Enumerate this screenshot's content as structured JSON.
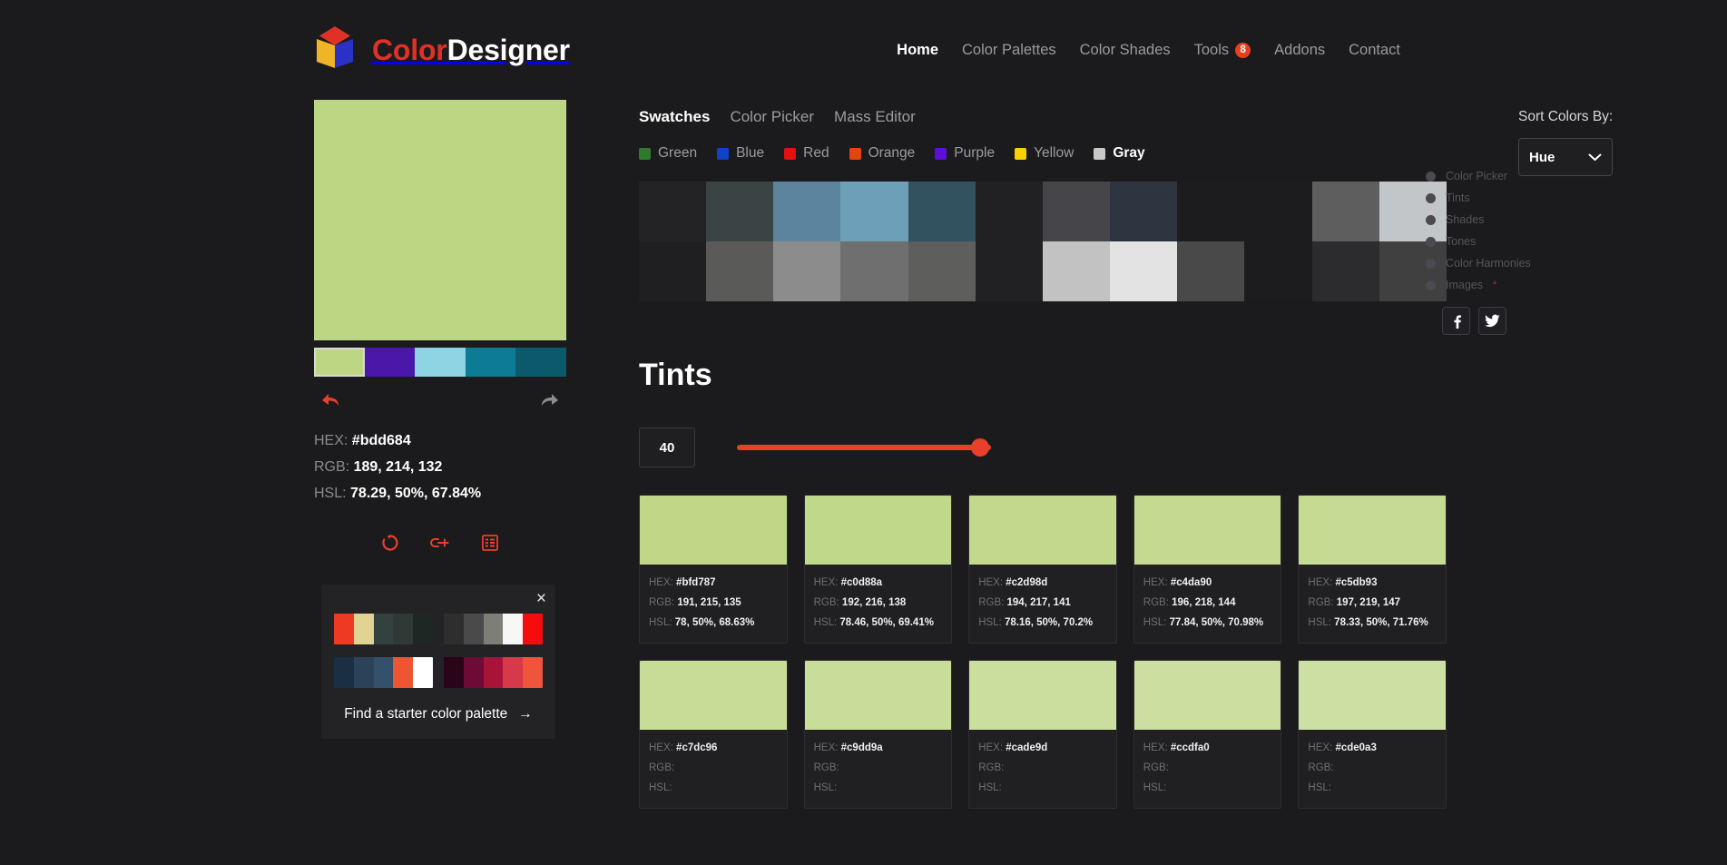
{
  "header": {
    "logo": {
      "part1": "Color",
      "part2": "Designer",
      "icon": "cube-logo-icon"
    },
    "nav": [
      {
        "label": "Home",
        "active": true
      },
      {
        "label": "Color Palettes",
        "active": false
      },
      {
        "label": "Color Shades",
        "active": false
      },
      {
        "label": "Tools",
        "active": false,
        "badge": "8"
      },
      {
        "label": "Addons",
        "active": false
      },
      {
        "label": "Contact",
        "active": false
      }
    ]
  },
  "left": {
    "main_color": "#bdd684",
    "palette": [
      {
        "hex": "#bdd684",
        "selected": true
      },
      {
        "hex": "#4b17a8",
        "selected": false
      },
      {
        "hex": "#8ed4e2",
        "selected": false
      },
      {
        "hex": "#0d7b94",
        "selected": false
      },
      {
        "hex": "#0b5a6b",
        "selected": false
      }
    ],
    "undo_label": "undo",
    "redo_label": "redo",
    "info": [
      {
        "label": "HEX:",
        "value": "#bdd684"
      },
      {
        "label": "RGB:",
        "value": "189, 214, 132"
      },
      {
        "label": "HSL:",
        "value": "78.29, 50%, 67.84%"
      }
    ],
    "actions": [
      {
        "name": "randomize-icon"
      },
      {
        "name": "add-color-icon"
      },
      {
        "name": "list-view-icon"
      }
    ],
    "starter": {
      "close_label": "×",
      "link_label": "Find a starter color palette",
      "arrow": "→",
      "palettes": [
        [
          "#ee3a23",
          "#e1d392",
          "#33413f",
          "#2f3a37",
          "#1f2724"
        ],
        [
          "#2e2e2e",
          "#4a4a4a",
          "#7e7e78",
          "#f7f7f7",
          "#f50d0d"
        ],
        [
          "#1a2f44",
          "#2b4259",
          "#ee5532",
          "#ffffff",
          "#ffffff"
        ],
        [
          "#2a0418",
          "#6d0a35",
          "#a81339",
          "#d6394a",
          "#ef553c"
        ]
      ]
    }
  },
  "main": {
    "tabs": [
      {
        "label": "Swatches",
        "active": true
      },
      {
        "label": "Color Picker",
        "active": false
      },
      {
        "label": "Mass Editor",
        "active": false
      }
    ],
    "categories": [
      {
        "label": "Green",
        "color": "#2d7a2d",
        "active": false
      },
      {
        "label": "Blue",
        "color": "#1042c8",
        "active": false
      },
      {
        "label": "Red",
        "color": "#e60f0f",
        "active": false
      },
      {
        "label": "Orange",
        "color": "#e2450f",
        "active": false
      },
      {
        "label": "Purple",
        "color": "#5c0fd8",
        "active": false
      },
      {
        "label": "Yellow",
        "color": "#fbd000",
        "active": false
      },
      {
        "label": "Gray",
        "color": "#c9c9c9",
        "active": true
      }
    ],
    "swatch_grid": {
      "rows": [
        [
          "#232326",
          "#3b4444",
          "#5d849e",
          "#6d9fb9",
          "#32525f",
          "#212124",
          "#45454a",
          "#2e3440",
          "#1c1c1f",
          "#1c1c1f",
          "#5e5e5e",
          "#c3c6c8"
        ],
        [
          "#1f1f22",
          "#5a5a58",
          "#8c8c8c",
          "#6f6f6f",
          "#5e5e5c",
          "#212124",
          "#c2c2c2",
          "#e3e3e3",
          "#49494a",
          "#1c1c1f",
          "#2c2c2f",
          "#404040"
        ]
      ]
    },
    "section_title": "Tints",
    "slider": {
      "value": "40",
      "min": "0",
      "max": "50",
      "fill_color": "#e8402a"
    },
    "tints": [
      {
        "chip": "#bfd787",
        "hex": "#bfd787",
        "rgb": "191, 215, 135",
        "hsl": "78, 50%, 68.63%"
      },
      {
        "chip": "#c0d88a",
        "hex": "#c0d88a",
        "rgb": "192, 216, 138",
        "hsl": "78.46, 50%, 69.41%"
      },
      {
        "chip": "#c2d98d",
        "hex": "#c2d98d",
        "rgb": "194, 217, 141",
        "hsl": "78.16, 50%, 70.2%"
      },
      {
        "chip": "#c4da90",
        "hex": "#c4da90",
        "rgb": "196, 218, 144",
        "hsl": "77.84, 50%, 70.98%"
      },
      {
        "chip": "#c5db93",
        "hex": "#c5db93",
        "rgb": "197, 219, 147",
        "hsl": "78.33, 50%, 71.76%"
      },
      {
        "chip": "#c7dc96",
        "hex": "#c7dc96",
        "rgb": "",
        "hsl": ""
      },
      {
        "chip": "#c9dd9a",
        "hex": "#c9dd9a",
        "rgb": "",
        "hsl": ""
      },
      {
        "chip": "#cade9d",
        "hex": "#cade9d",
        "rgb": "",
        "hsl": ""
      },
      {
        "chip": "#ccdfa0",
        "hex": "#ccdfa0",
        "rgb": "",
        "hsl": ""
      },
      {
        "chip": "#cde0a3",
        "hex": "#cde0a3",
        "rgb": "",
        "hsl": ""
      }
    ],
    "meta_labels": {
      "hex": "HEX:",
      "rgb": "RGB:",
      "hsl": "HSL:"
    }
  },
  "right": {
    "sort_label": "Sort Colors By:",
    "sort_value": "Hue",
    "side_nav": [
      {
        "label": "Color Picker",
        "star": ""
      },
      {
        "label": "Tints",
        "star": ""
      },
      {
        "label": "Shades",
        "star": ""
      },
      {
        "label": "Tones",
        "star": ""
      },
      {
        "label": "Color Harmonies",
        "star": ""
      },
      {
        "label": "Images",
        "star": "*"
      }
    ],
    "socials": [
      {
        "name": "facebook-icon",
        "glyph": "f"
      },
      {
        "name": "twitter-icon",
        "glyph": "t"
      }
    ]
  }
}
